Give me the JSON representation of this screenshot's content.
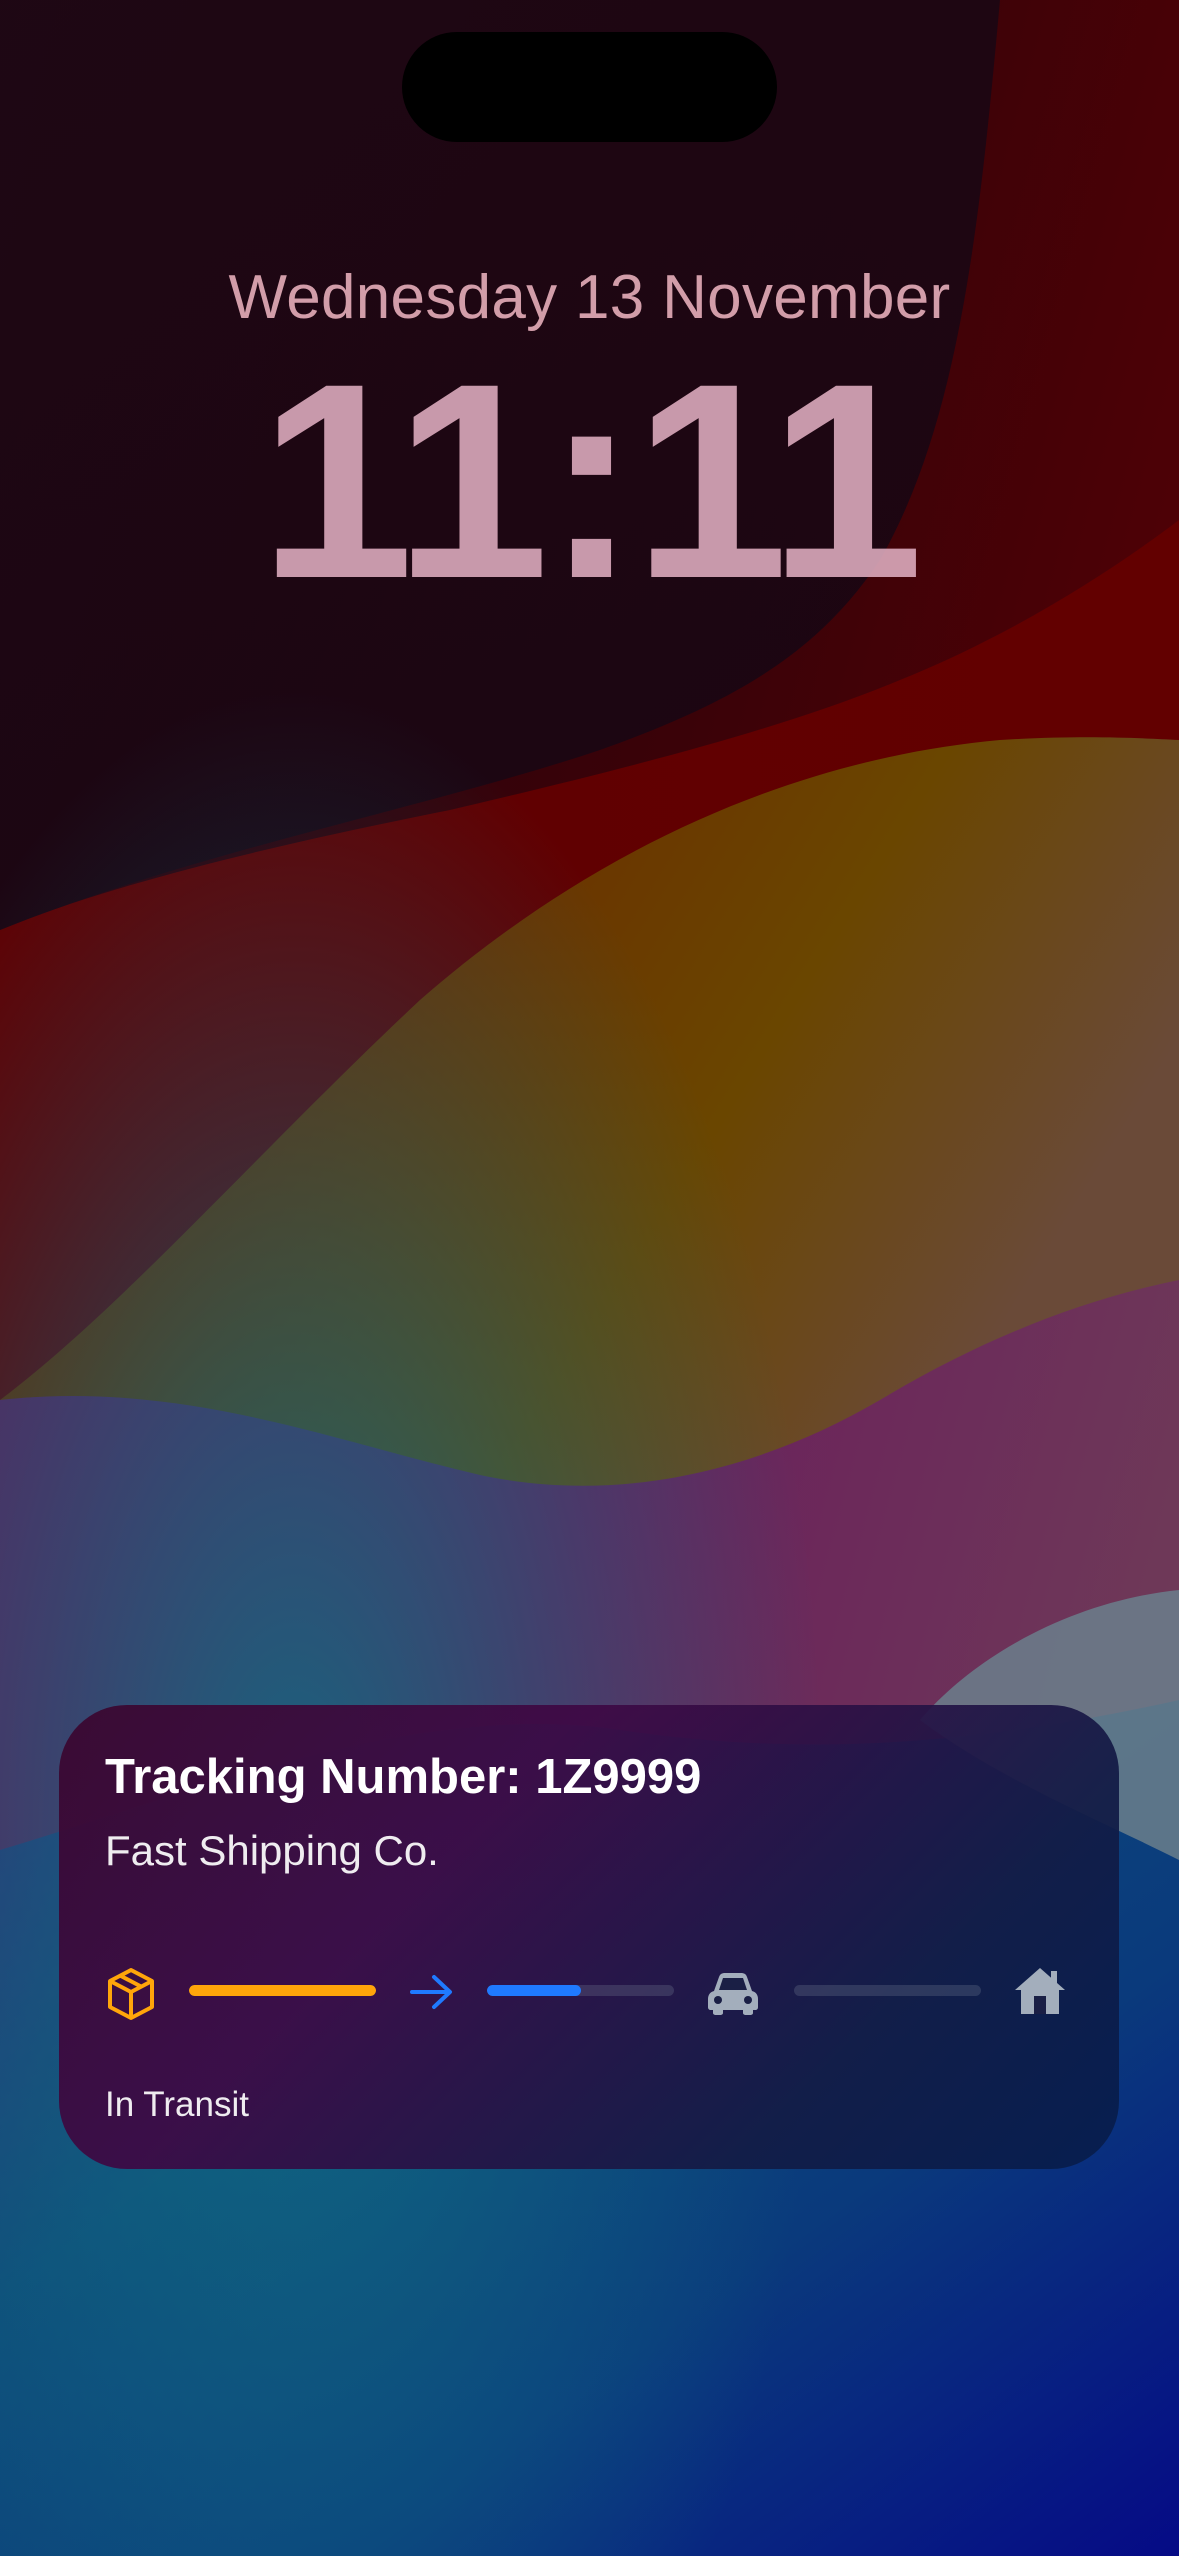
{
  "lock_screen": {
    "date": "Wednesday 13 November",
    "time": "11:11"
  },
  "live_activity": {
    "title": "Tracking Number: 1Z9999",
    "carrier": "Fast Shipping Co.",
    "status": "In Transit",
    "progress": {
      "stages": [
        {
          "icon": "package-icon",
          "color": "#FFA50A"
        },
        {
          "icon": "arrow-right-icon",
          "color": "#1F7AFF"
        },
        {
          "icon": "car-icon",
          "color": "#A3AEBC"
        },
        {
          "icon": "house-icon",
          "color": "#A3AEBC"
        }
      ],
      "segments": [
        {
          "fraction": 1.0,
          "color": "#FFA50A"
        },
        {
          "fraction": 0.5,
          "color": "#1F7AFF"
        },
        {
          "fraction": 0.0,
          "color": "#A3AEBC"
        }
      ]
    }
  }
}
